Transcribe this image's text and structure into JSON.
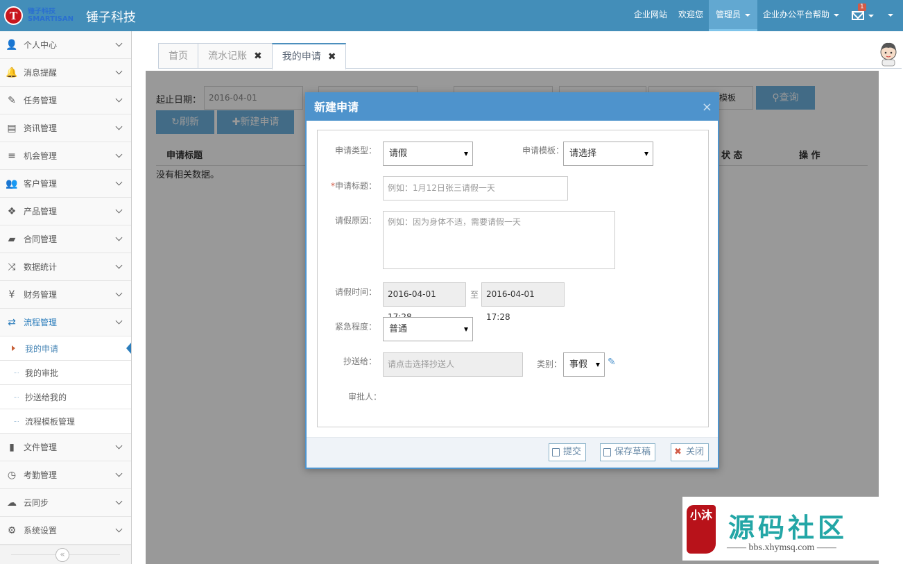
{
  "app": {
    "brand": "锤子科技",
    "logo_letter": "T",
    "logo_text": "锤子科技 SMARTISAN"
  },
  "topnav": {
    "items": [
      "企业网站",
      "欢迎您",
      "管理员",
      "企业办公平台帮助"
    ],
    "mail_count": "1"
  },
  "sidebar": {
    "items": [
      {
        "label": "个人中心",
        "icon": "user-icon"
      },
      {
        "label": "消息提醒",
        "icon": "bell-icon"
      },
      {
        "label": "任务管理",
        "icon": "edit-icon"
      },
      {
        "label": "资讯管理",
        "icon": "file-text-icon"
      },
      {
        "label": "机会管理",
        "icon": "list-icon"
      },
      {
        "label": "客户管理",
        "icon": "users-icon"
      },
      {
        "label": "产品管理",
        "icon": "dropbox-icon"
      },
      {
        "label": "合同管理",
        "icon": "folder-open-icon"
      },
      {
        "label": "数据统计",
        "icon": "random-icon"
      },
      {
        "label": "财务管理",
        "icon": "yen-icon"
      },
      {
        "label": "流程管理",
        "icon": "retweet-icon"
      }
    ],
    "subitems": [
      "我的申请",
      "我的审批",
      "抄送给我的",
      "流程模板管理"
    ],
    "items_after": [
      {
        "label": "文件管理",
        "icon": "file-icon"
      },
      {
        "label": "考勤管理",
        "icon": "clock-icon"
      },
      {
        "label": "云同步",
        "icon": "cloud-upload-icon"
      },
      {
        "label": "系统设置",
        "icon": "cog-icon"
      }
    ],
    "collapse": "«"
  },
  "tabs": [
    {
      "label": "首页",
      "closable": false
    },
    {
      "label": "流水记账",
      "closable": true
    },
    {
      "label": "我的申请",
      "closable": true,
      "active": true
    }
  ],
  "filter": {
    "start_date_label": "起止日期：",
    "start_date_value": "2016-04-01",
    "template_placeholder_tail": "模板",
    "query_button": "查询",
    "refresh_button": "刷新",
    "new_button": "新建申请"
  },
  "table": {
    "headers": [
      "申请标题",
      "状 态",
      "操 作"
    ],
    "empty_text": "没有相关数据。"
  },
  "modal": {
    "title": "新建申请",
    "close": "×",
    "type_label": "申请类型：",
    "type_value": "请假",
    "template_label": "申请模板：",
    "template_value": "请选择",
    "title_label": "申请标题：",
    "title_placeholder": "例如：1月12日张三请假一天",
    "reason_label": "请假原因：",
    "reason_placeholder": "例如：因为身体不适，需要请假一天",
    "time_label": "请假时间：",
    "time_start": "2016-04-01 17:28",
    "time_to": "至",
    "time_end": "2016-04-01 17:28",
    "urgency_label": "紧急程度：",
    "urgency_value": "普通",
    "cc_label": "抄送给：",
    "cc_placeholder": "请点击选择抄送人",
    "category_label": "类别：",
    "category_value": "事假",
    "approver_label": "审批人：",
    "submit_button": "提交",
    "draft_button": "保存草稿",
    "close_button": "关闭"
  },
  "watermark": {
    "seal_text": "小沐",
    "title": "源码社区",
    "url": "—— bbs.xhymsq.com ——"
  },
  "colors": {
    "nav": "#438eb9",
    "accent": "#4e93cc",
    "button": "#6fb3e0",
    "danger": "#d15b47"
  }
}
